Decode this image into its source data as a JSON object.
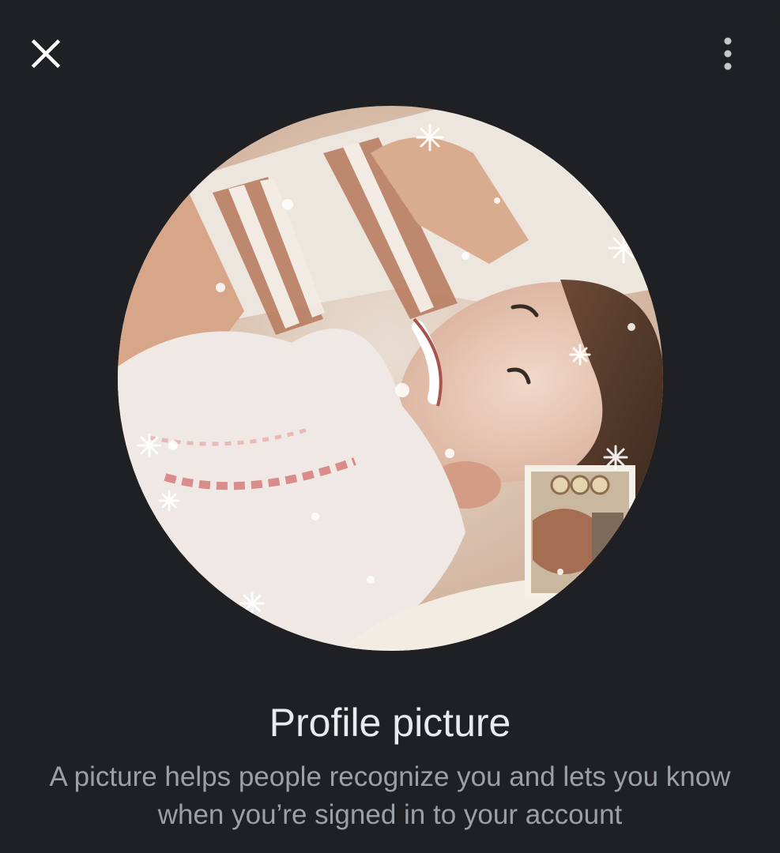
{
  "dialog": {
    "title": "Profile picture",
    "description": "A picture helps people recognize you and lets you know when you’re signed in to your account"
  },
  "toolbar": {
    "close_icon": "close-icon",
    "more_icon": "more-vert-icon"
  },
  "avatar": {
    "image": "profile-photo"
  },
  "colors": {
    "background": "#1f2023",
    "title": "#e8eaed",
    "description": "#9aa0a6",
    "icon": "#ffffff",
    "more_icon": "#c4c7c5"
  }
}
